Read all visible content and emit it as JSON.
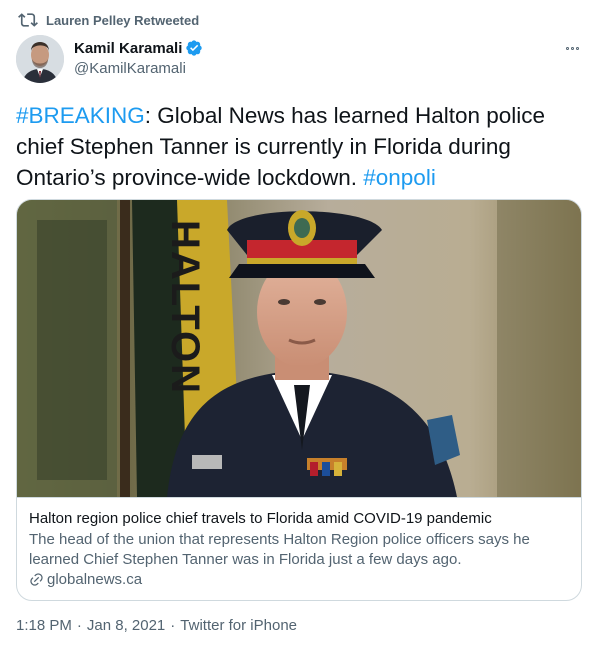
{
  "retweet": {
    "icon": "retweet-icon",
    "label": "Lauren Pelley Retweeted"
  },
  "author": {
    "name": "Kamil Karamali",
    "handle": "@KamilKaramali",
    "verified": true,
    "verified_icon": "verified-badge-icon",
    "avatar": "avatar"
  },
  "more_icon": "more-options-icon",
  "tweet": {
    "hashtag_breaking": "#BREAKING",
    "body": ": Global News has learned Halton police chief Stephen Tanner is currently in Florida during Ontario’s province-wide lockdown. ",
    "hashtag_onpoli": "#onpoli"
  },
  "card": {
    "image_flag_text": "HALTON",
    "title": "Halton region police chief travels to Florida amid COVID-19 pandemic",
    "description": "The head of the union that represents Halton Region police officers says he learned Chief Stephen Tanner was in Florida just a few days ago.",
    "domain": "globalnews.ca",
    "link_icon": "link-icon"
  },
  "footer": {
    "time": "1:18 PM",
    "separator_1": "·",
    "date": "Jan 8, 2021",
    "separator_2": "·",
    "source": "Twitter for iPhone"
  },
  "colors": {
    "link_blue": "#1d9bf0",
    "secondary_text": "#536471",
    "border": "#cfd9de",
    "primary_text": "#0f1419"
  }
}
